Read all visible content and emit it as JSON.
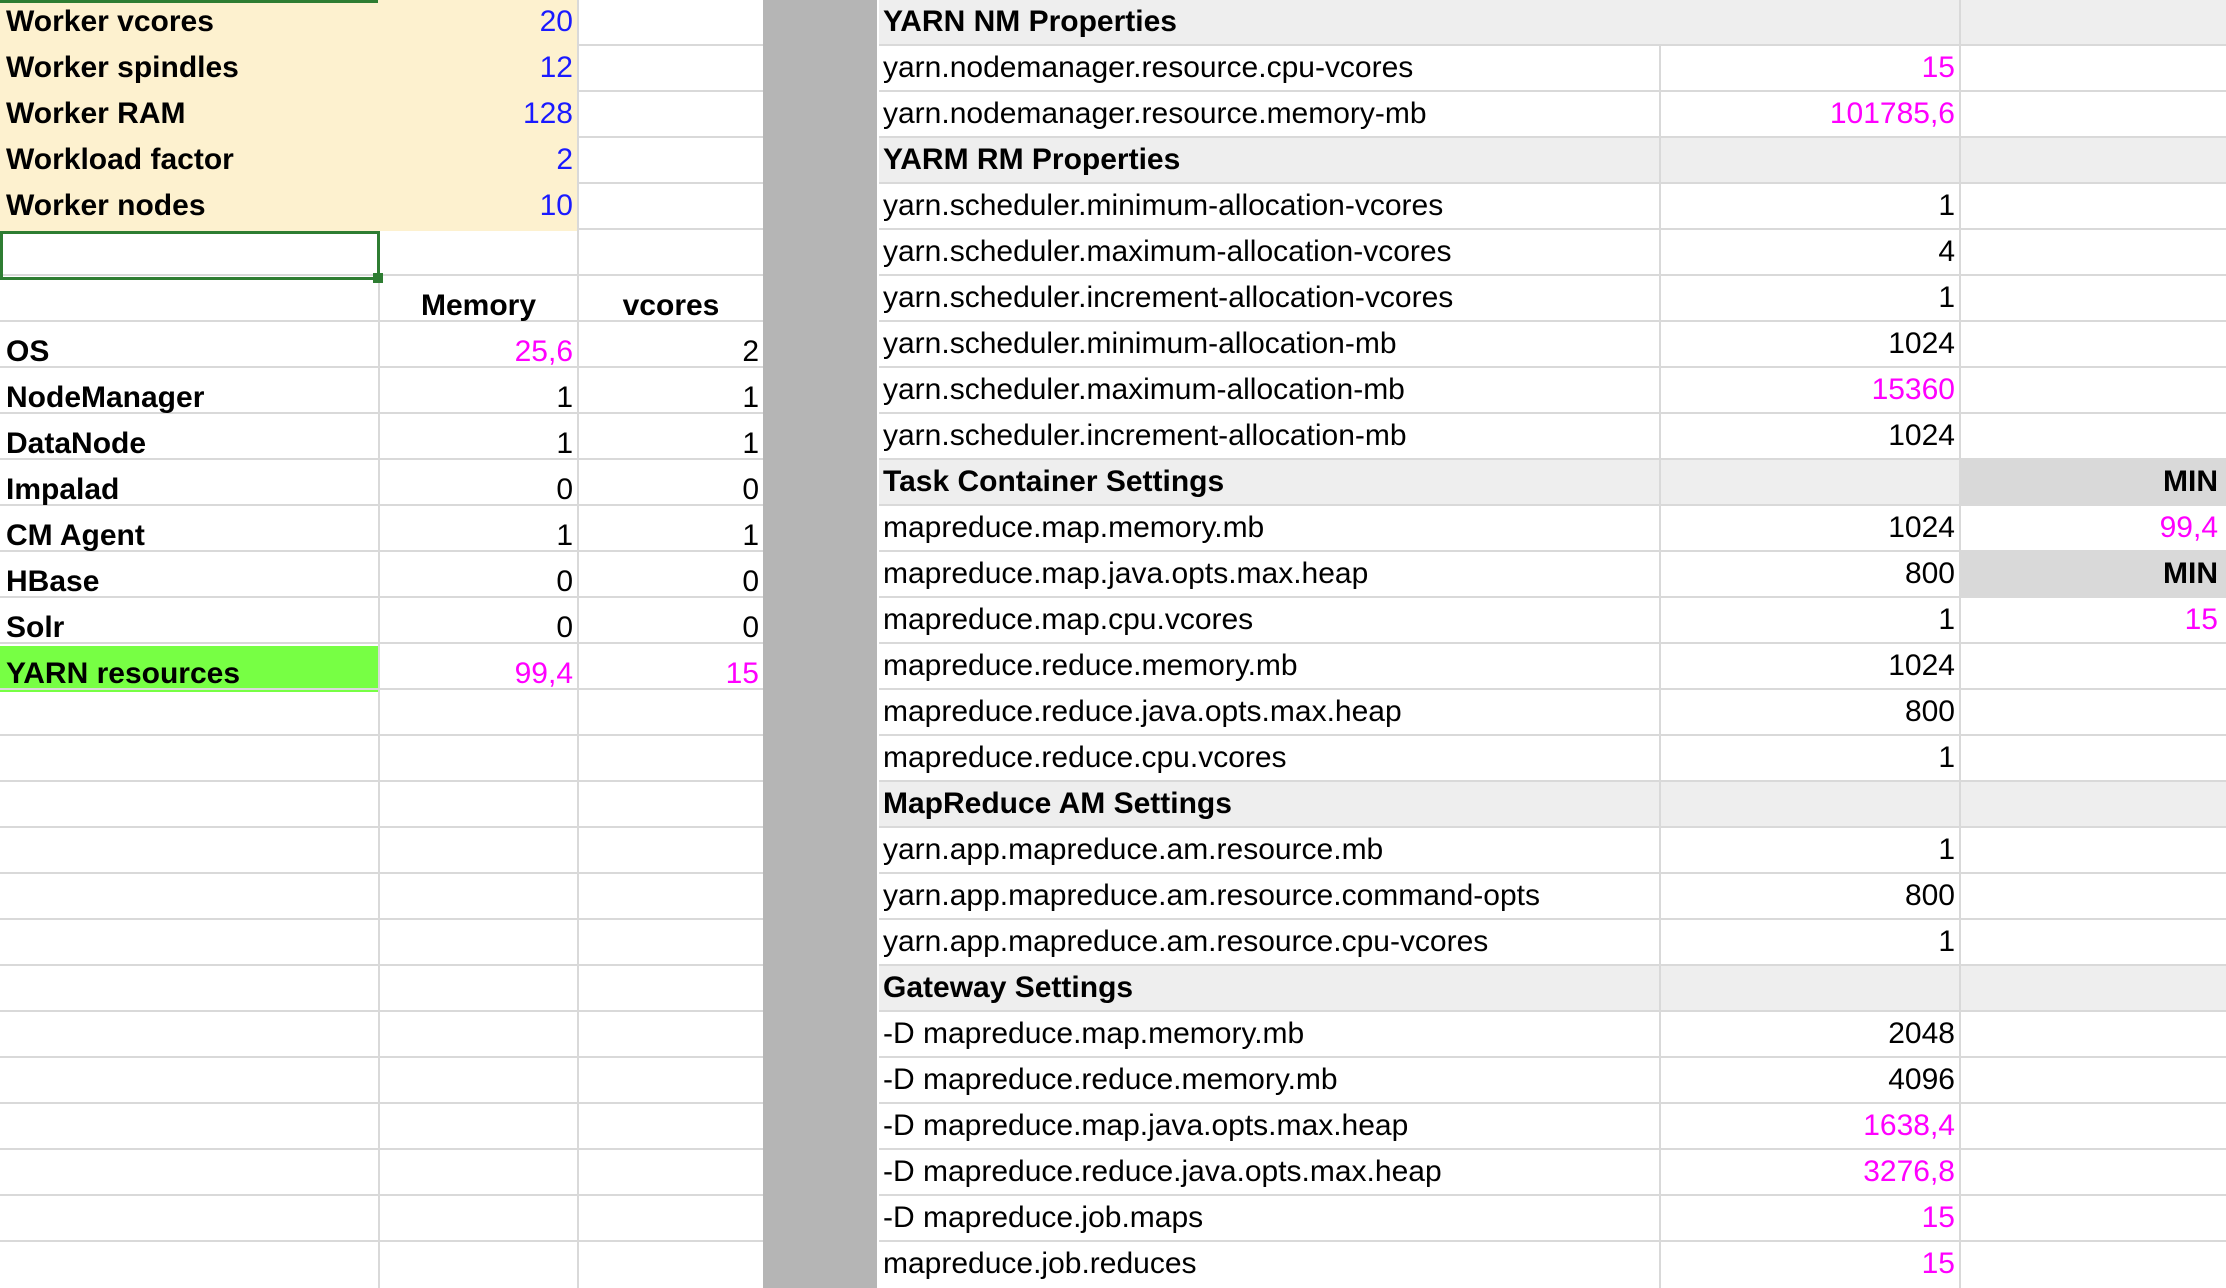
{
  "inputs": {
    "worker_vcores": {
      "label": "Worker vcores",
      "value": "20"
    },
    "worker_spindles": {
      "label": "Worker spindles",
      "value": "12"
    },
    "worker_ram": {
      "label": "Worker RAM",
      "value": "128"
    },
    "workload_factor": {
      "label": "Workload factor",
      "value": "2"
    },
    "worker_nodes": {
      "label": "Worker nodes",
      "value": "10"
    }
  },
  "resources": {
    "col_memory": "Memory",
    "col_vcores": "vcores",
    "rows": [
      {
        "label": "OS",
        "memory": "25,6",
        "vcores": "2"
      },
      {
        "label": "NodeManager",
        "memory": "1",
        "vcores": "1"
      },
      {
        "label": "DataNode",
        "memory": "1",
        "vcores": "1"
      },
      {
        "label": "Impalad",
        "memory": "0",
        "vcores": "0"
      },
      {
        "label": "CM Agent",
        "memory": "1",
        "vcores": "1"
      },
      {
        "label": "HBase",
        "memory": "0",
        "vcores": "0"
      },
      {
        "label": "Solr",
        "memory": "0",
        "vcores": "0"
      }
    ],
    "total": {
      "label": "YARN resources",
      "memory": "99,4",
      "vcores": "15"
    }
  },
  "properties": {
    "nm_header": "YARN NM Properties",
    "nm_rows": [
      {
        "name": "yarn.nodemanager.resource.cpu-vcores",
        "value": "15"
      },
      {
        "name": "yarn.nodemanager.resource.memory-mb",
        "value": "101785,6"
      }
    ],
    "rm_header": "YARM RM Properties",
    "rm_rows": [
      {
        "name": "yarn.scheduler.minimum-allocation-vcores",
        "value": "1"
      },
      {
        "name": "yarn.scheduler.maximum-allocation-vcores",
        "value": "4"
      },
      {
        "name": "yarn.scheduler.increment-allocation-vcores",
        "value": "1"
      },
      {
        "name": "yarn.scheduler.minimum-allocation-mb",
        "value": "1024"
      },
      {
        "name": "yarn.scheduler.maximum-allocation-mb",
        "value": "15360"
      },
      {
        "name": "yarn.scheduler.increment-allocation-mb",
        "value": "1024"
      }
    ],
    "task_header": "Task Container Settings",
    "task_min_label": "MIN",
    "task_rows": [
      {
        "name": "mapreduce.map.memory.mb",
        "value": "1024",
        "extra": "99,4"
      },
      {
        "name": "mapreduce.map.java.opts.max.heap",
        "value": "800",
        "extra": "MIN"
      },
      {
        "name": "mapreduce.map.cpu.vcores",
        "value": "1",
        "extra": "15"
      },
      {
        "name": "mapreduce.reduce.memory.mb",
        "value": "1024",
        "extra": ""
      },
      {
        "name": "mapreduce.reduce.java.opts.max.heap",
        "value": "800",
        "extra": ""
      },
      {
        "name": "mapreduce.reduce.cpu.vcores",
        "value": "1",
        "extra": ""
      }
    ],
    "am_header": "MapReduce AM Settings",
    "am_rows": [
      {
        "name": "yarn.app.mapreduce.am.resource.mb",
        "value": "1"
      },
      {
        "name": "yarn.app.mapreduce.am.resource.command-opts",
        "value": "800"
      },
      {
        "name": "yarn.app.mapreduce.am.resource.cpu-vcores",
        "value": "1"
      }
    ],
    "gw_header": "Gateway Settings",
    "gw_rows": [
      {
        "name": "-D mapreduce.map.memory.mb",
        "value": "2048"
      },
      {
        "name": "-D mapreduce.reduce.memory.mb",
        "value": "4096"
      },
      {
        "name": "-D mapreduce.map.java.opts.max.heap",
        "value": "1638,4"
      },
      {
        "name": "-D mapreduce.reduce.java.opts.max.heap",
        "value": "3276,8"
      },
      {
        "name": "-D mapreduce.job.maps",
        "value": "15"
      },
      {
        "name": "mapreduce.job.reduces",
        "value": "15"
      }
    ]
  },
  "colors": {
    "input_fill": "#fdf1cf",
    "total_fill": "#77ff44",
    "input_value": "#1a1aff",
    "computed_value": "#ff00ff",
    "separator": "#b5b5b5"
  }
}
